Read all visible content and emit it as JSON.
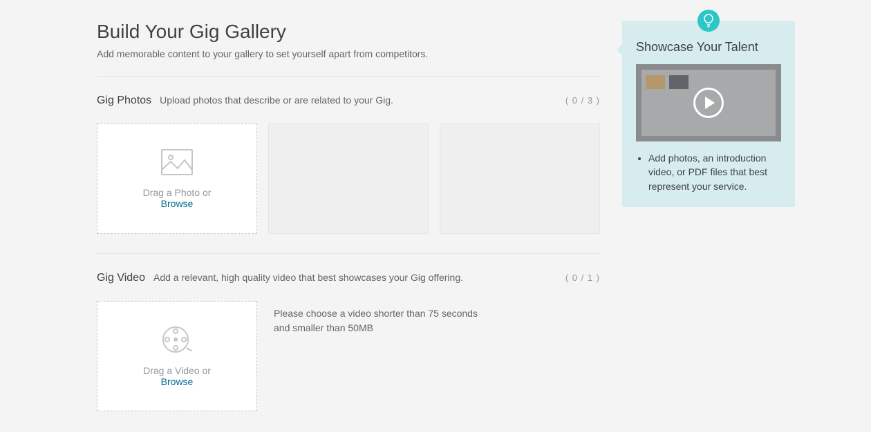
{
  "header": {
    "title": "Build Your Gig Gallery",
    "subtitle": "Add memorable content to your gallery to set yourself apart from competitors."
  },
  "photos": {
    "title": "Gig Photos",
    "desc": "Upload photos that describe or are related to your Gig.",
    "counter": "( 0 / 3 )",
    "drop_text": "Drag a Photo or",
    "browse_label": "Browse"
  },
  "video": {
    "title": "Gig Video",
    "desc": "Add a relevant, high quality video that best showcases your Gig offering.",
    "counter": "( 0 / 1 )",
    "drop_text": "Drag a Video or",
    "browse_label": "Browse",
    "hint": "Please choose a video shorter than 75 seconds and smaller than 50MB"
  },
  "tip": {
    "title": "Showcase Your Talent",
    "bullet": "Add photos, an introduction video, or PDF files that best represent your service."
  }
}
